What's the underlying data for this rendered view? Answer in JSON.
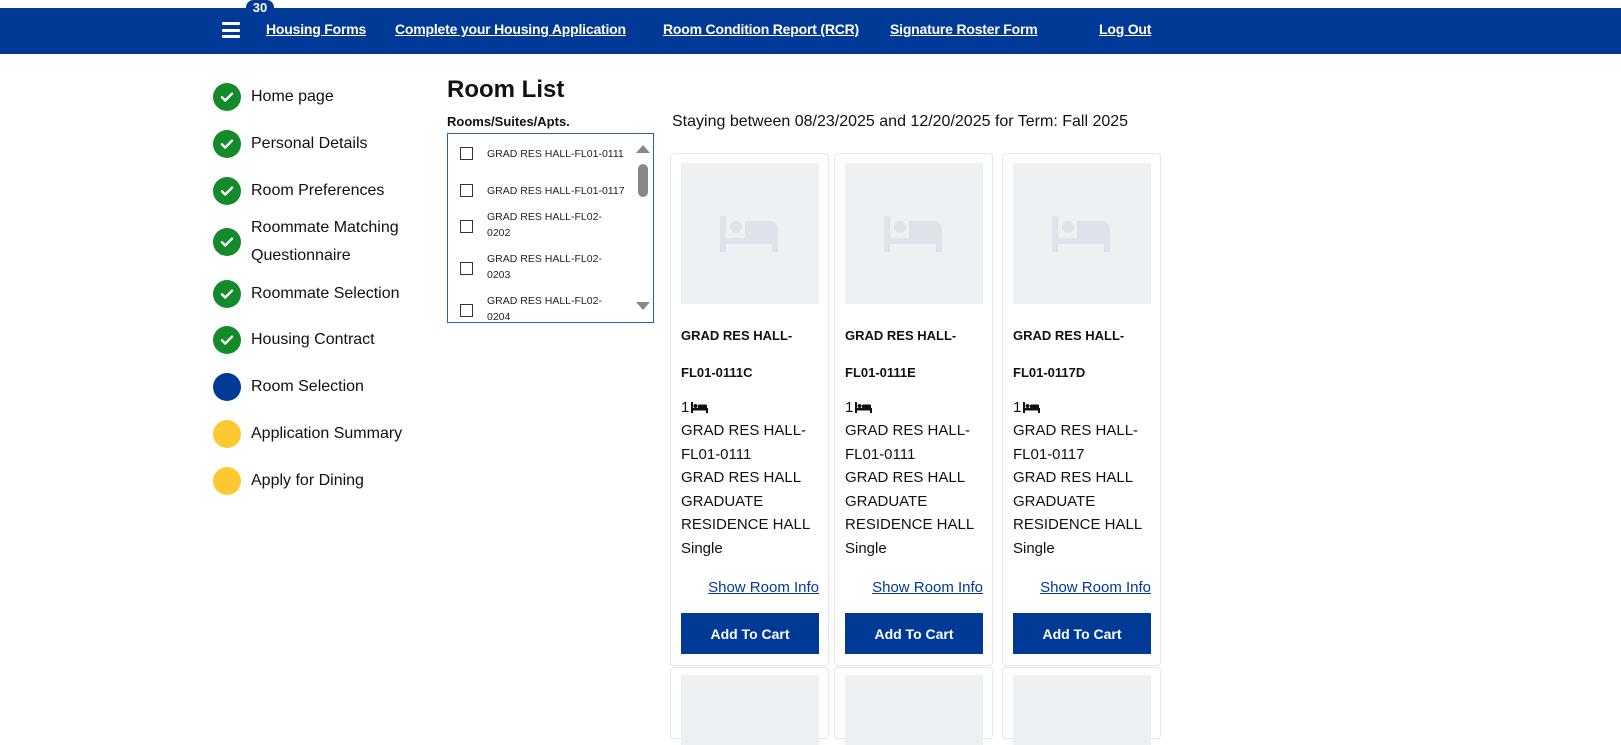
{
  "header": {
    "badge_count": "30",
    "menu_icon": "hamburger-menu-icon",
    "nav": [
      {
        "label": "Housing Forms"
      },
      {
        "label": "Complete your Housing Application"
      },
      {
        "label": "Room Condition Report (RCR)"
      },
      {
        "label": "Signature Roster Form"
      },
      {
        "label": "Log Out"
      }
    ],
    "color": "#003a96"
  },
  "steps": [
    {
      "label": "Home page",
      "status": "done"
    },
    {
      "label": "Personal Details",
      "status": "done"
    },
    {
      "label": "Room Preferences",
      "status": "done"
    },
    {
      "label": "Roommate Matching Questionnaire",
      "status": "done"
    },
    {
      "label": "Roommate Selection",
      "status": "done"
    },
    {
      "label": "Housing Contract",
      "status": "done"
    },
    {
      "label": "Room Selection",
      "status": "current"
    },
    {
      "label": "Application Summary",
      "status": "todo"
    },
    {
      "label": "Apply for Dining",
      "status": "todo"
    }
  ],
  "room_list": {
    "title": "Room List",
    "filter_label": "Rooms/Suites/Apts.",
    "options": [
      {
        "label": "GRAD RES HALL-FL01-0111",
        "checked": false
      },
      {
        "label": "GRAD RES HALL-FL01-0117",
        "checked": false
      },
      {
        "label": "GRAD RES HALL-FL02-0202",
        "checked": false
      },
      {
        "label": "GRAD RES HALL-FL02-0203",
        "checked": false
      },
      {
        "label": "GRAD RES HALL-FL02-0204",
        "checked": false
      }
    ],
    "staying_text": "Staying between 08/23/2025 and 12/20/2025 for Term: Fall 2025"
  },
  "cards": [
    {
      "name_line1": "GRAD RES HALL-",
      "name_line2": "FL01-0111C",
      "capacity": "1",
      "room": "GRAD RES HALL-FL01-0111",
      "building": "GRAD RES HALL",
      "hall": "GRADUATE RESIDENCE HALL",
      "type": "Single",
      "info_link": "Show Room Info",
      "button": "Add To Cart"
    },
    {
      "name_line1": "GRAD RES HALL-",
      "name_line2": "FL01-0111E",
      "capacity": "1",
      "room": "GRAD RES HALL-FL01-0111",
      "building": "GRAD RES HALL",
      "hall": "GRADUATE RESIDENCE HALL",
      "type": "Single",
      "info_link": "Show Room Info",
      "button": "Add To Cart"
    },
    {
      "name_line1": "GRAD RES HALL-",
      "name_line2": "FL01-0117D",
      "capacity": "1",
      "room": "GRAD RES HALL-FL01-0117",
      "building": "GRAD RES HALL",
      "hall": "GRADUATE RESIDENCE HALL",
      "type": "Single",
      "info_link": "Show Room Info",
      "button": "Add To Cart"
    }
  ]
}
